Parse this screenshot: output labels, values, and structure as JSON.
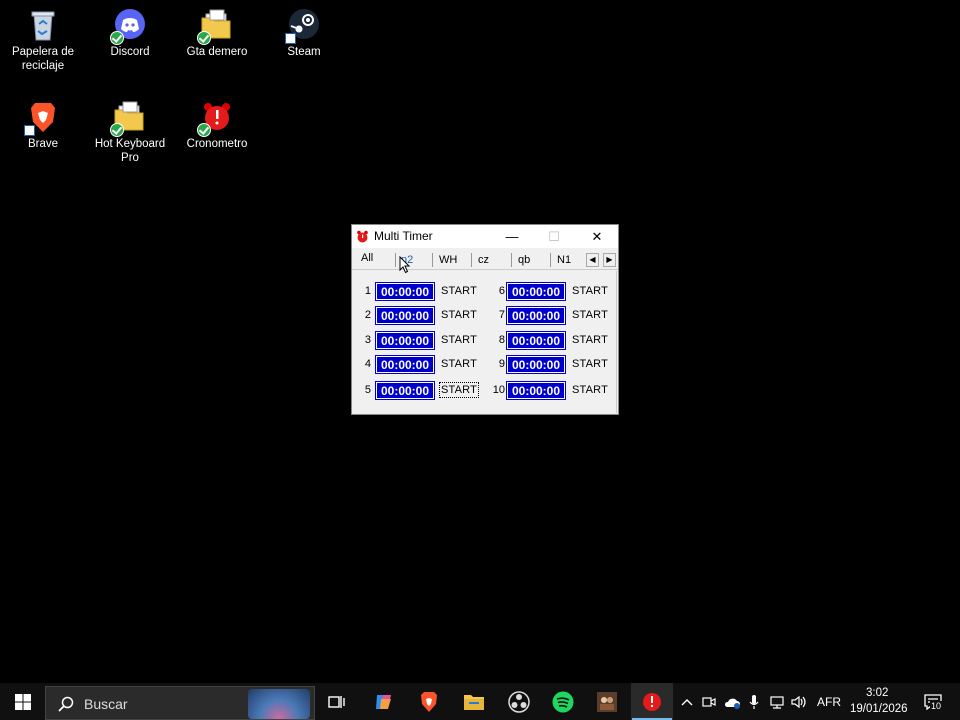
{
  "desktop": {
    "icons": [
      {
        "label": "Papelera de reciclaje",
        "icon": "recycle-bin-icon"
      },
      {
        "label": "Discord",
        "icon": "discord-icon"
      },
      {
        "label": "Gta demero",
        "icon": "folder-icon"
      },
      {
        "label": "Steam",
        "icon": "steam-icon"
      },
      {
        "label": "Brave",
        "icon": "brave-icon"
      },
      {
        "label": "Hot Keyboard Pro",
        "icon": "folder-icon"
      },
      {
        "label": "Cronometro",
        "icon": "alarm-clock-icon"
      }
    ]
  },
  "window": {
    "title": "Multi Timer",
    "controls": {
      "minimize": "—",
      "maximize": "☐",
      "close": "✕"
    },
    "tabs": [
      "All",
      "n2",
      "WH",
      "cz",
      "qb",
      "N1"
    ],
    "active_tab": "All",
    "timers": [
      {
        "num": "1",
        "time": "00:00:00",
        "action": "START"
      },
      {
        "num": "2",
        "time": "00:00:00",
        "action": "START"
      },
      {
        "num": "3",
        "time": "00:00:00",
        "action": "START"
      },
      {
        "num": "4",
        "time": "00:00:00",
        "action": "START"
      },
      {
        "num": "5",
        "time": "00:00:00",
        "action": "START"
      },
      {
        "num": "6",
        "time": "00:00:00",
        "action": "START"
      },
      {
        "num": "7",
        "time": "00:00:00",
        "action": "START"
      },
      {
        "num": "8",
        "time": "00:00:00",
        "action": "START"
      },
      {
        "num": "9",
        "time": "00:00:00",
        "action": "START"
      },
      {
        "num": "10",
        "time": "00:00:00",
        "action": "START"
      }
    ]
  },
  "taskbar": {
    "search_placeholder": "Buscar",
    "apps": [
      "task-view-icon",
      "copilot-icon",
      "brave-icon",
      "file-explorer-icon",
      "obs-icon",
      "spotify-icon",
      "game-icon",
      "multi-timer-icon"
    ],
    "tray": {
      "language": "AFR",
      "time": "3:02",
      "date": "19/01/2026",
      "notifications": "10"
    }
  },
  "colors": {
    "timer_display_bg": "#0000cc",
    "timer_display_fg": "#ffffff",
    "desktop_bg": "#000000",
    "taskbar_bg": "#101010"
  }
}
